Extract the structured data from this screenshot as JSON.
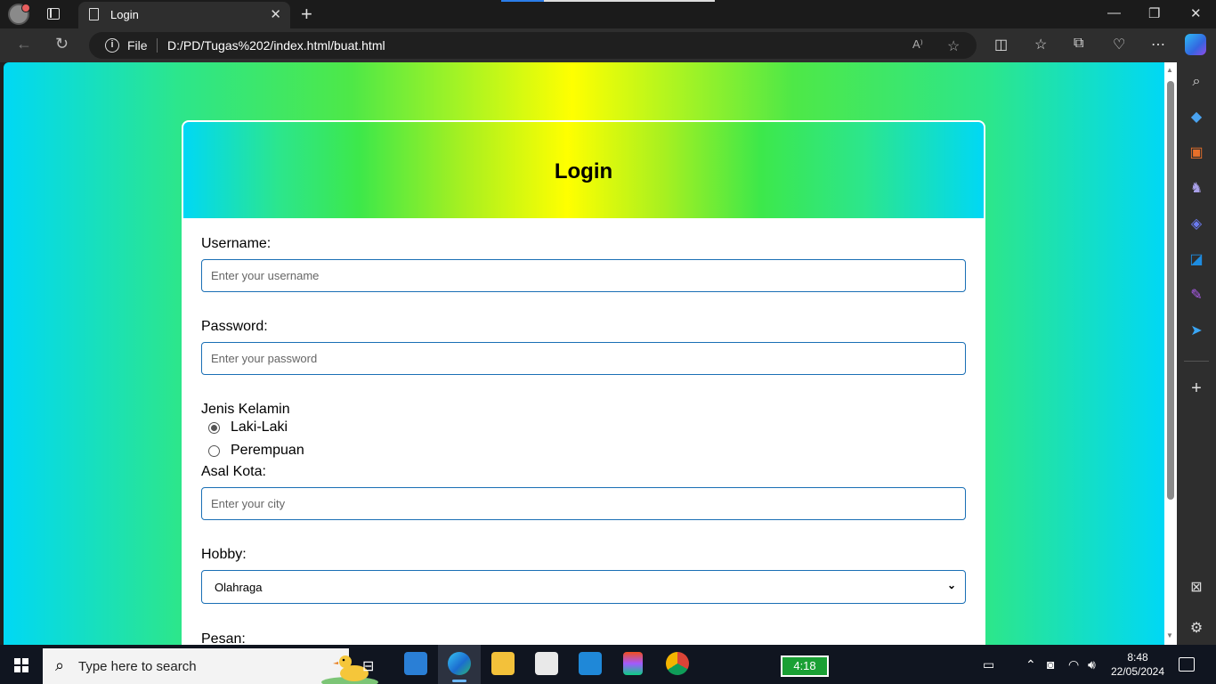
{
  "browser": {
    "tab_title": "Login",
    "tab_close": "✕",
    "new_tab": "+",
    "address_scheme": "File",
    "address_url": "D:/PD/Tugas%202/index.html/buat.html",
    "window_minimize": "—",
    "window_restore": "❐",
    "window_close": "✕"
  },
  "page": {
    "title": "Login",
    "username_label": "Username:",
    "username_placeholder": "Enter your username",
    "password_label": "Password:",
    "password_placeholder": "Enter your password",
    "gender_label": "Jenis Kelamin",
    "gender_options": [
      {
        "label": "Laki-Laki",
        "checked": true
      },
      {
        "label": "Perempuan",
        "checked": false
      }
    ],
    "city_label": "Asal Kota:",
    "city_placeholder": "Enter your city",
    "hobby_label": "Hobby:",
    "hobby_selected": "Olahraga",
    "message_label": "Pesan:"
  },
  "taskbar": {
    "search_placeholder": "Type here to search",
    "battery_text": "4:18",
    "time": "8:48",
    "date": "22/05/2024"
  },
  "colors": {
    "gradient_cyan": "#00d8f5",
    "gradient_green": "#3de84a",
    "gradient_yellow": "#ffff00",
    "input_border": "#1a6fb5"
  },
  "icons": [
    "profile-avatar-icon",
    "tab-actions-icon",
    "page-icon",
    "back-icon",
    "refresh-icon",
    "info-icon",
    "read-aloud-icon",
    "favorite-star-icon",
    "split-screen-icon",
    "favorites-icon",
    "collections-icon",
    "performance-icon",
    "more-icon",
    "copilot-icon",
    "search-icon",
    "shopping-tag-icon",
    "tools-icon",
    "games-icon",
    "microsoft365-icon",
    "outlook-icon",
    "designer-icon",
    "send-icon",
    "add-icon",
    "screenshot-icon",
    "settings-icon"
  ]
}
